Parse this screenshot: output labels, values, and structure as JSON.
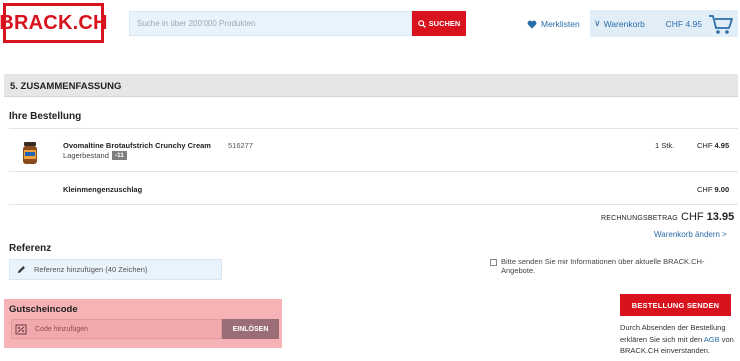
{
  "header": {
    "logo_text": "BRACK.CH",
    "search_placeholder": "Suche in über 200'000 Produkten",
    "search_button": "SUCHEN",
    "wishlist_label": "Merklisten",
    "cart_label": "Warenkorb",
    "cart_total": "CHF 4.95"
  },
  "summary": {
    "section_title": "5. ZUSAMMENFASSUNG",
    "order_title": "Ihre Bestellung"
  },
  "items": [
    {
      "name": "Ovomaltine Brotaufstrich Crunchy Cream",
      "stock_label": "Lagerbestand",
      "stock_badge": "-11",
      "article_number": "516277",
      "quantity": "1 Stk.",
      "currency": "CHF",
      "price": "4.95"
    },
    {
      "name": "Kleinmengenzuschlag",
      "currency": "CHF",
      "price": "9.00"
    }
  ],
  "totals": {
    "label": "RECHNUNGSBETRAG",
    "currency": "CHF",
    "amount": "13.95",
    "change_cart_link": "Warenkorb ändern >"
  },
  "reference": {
    "title": "Referenz",
    "placeholder": "Referenz hinzufügen (40 Zeichen)"
  },
  "newsletter": {
    "label": "Bitte senden Sie mir Informationen über aktuelle BRACK.CH-Angebote.",
    "checked": false
  },
  "voucher": {
    "title": "Gutscheincode",
    "placeholder": "Code hinzufügen",
    "button": "EINLÖSEN"
  },
  "submit": {
    "button": "BESTELLUNG SENDEN",
    "agb_prefix": "Durch Absenden der Bestellung erklären Sie sich mit den",
    "agb_link": "AGB",
    "agb_suffix": "von BRACK.CH einverstanden."
  },
  "colors": {
    "brand_red": "#d8131d",
    "link_blue": "#2c6ca8",
    "highlight_pink": "#f6b3b5"
  }
}
